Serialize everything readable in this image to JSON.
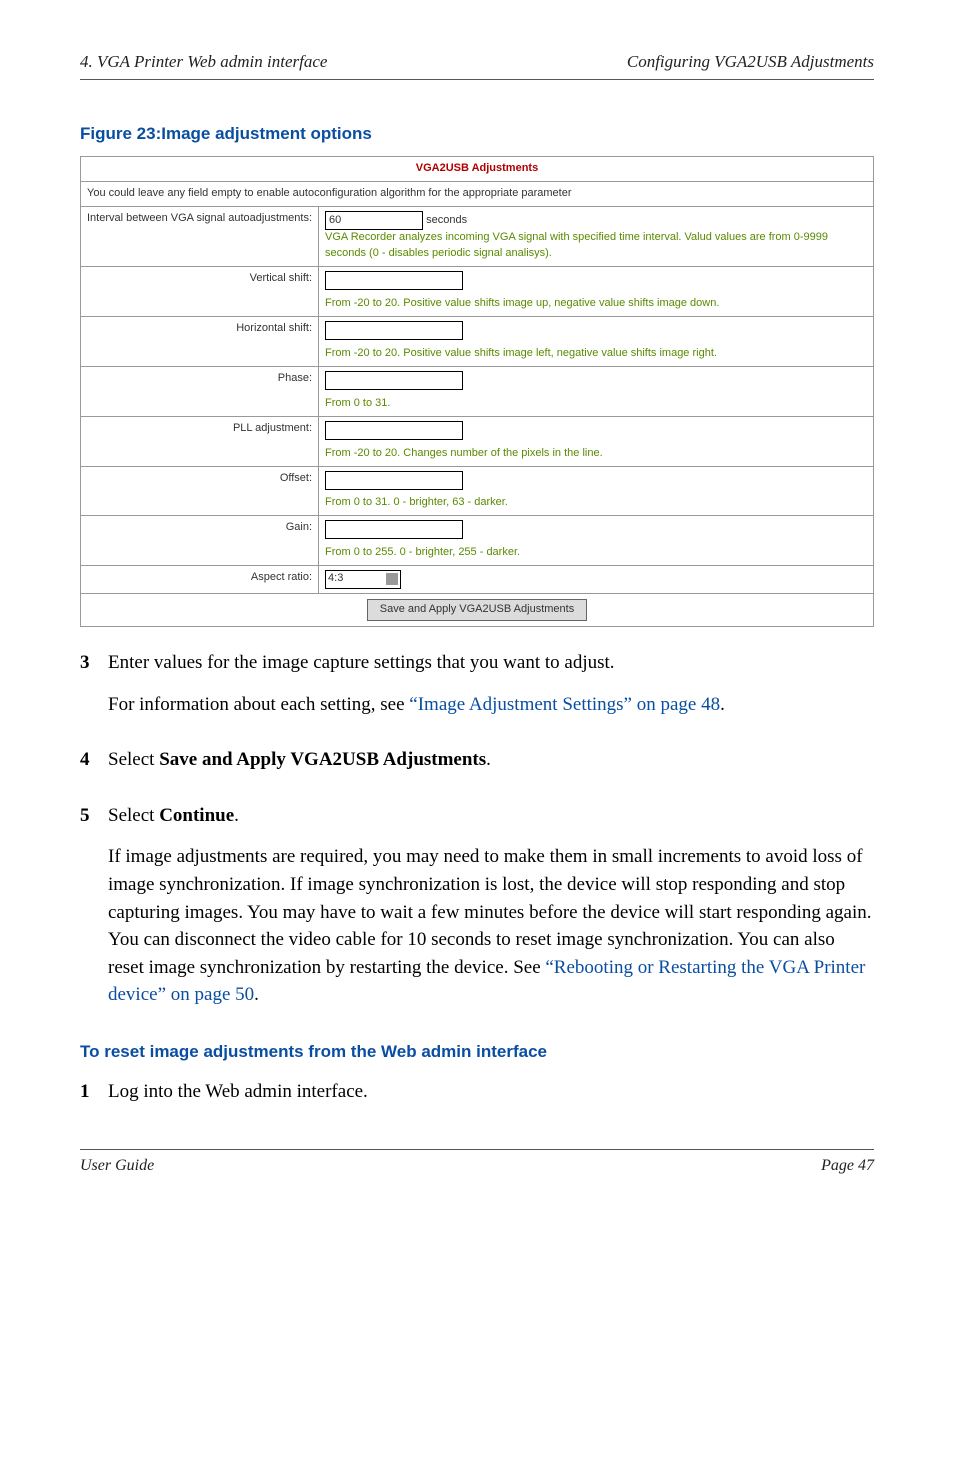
{
  "header": {
    "left": "4. VGA Printer Web admin interface",
    "right": "Configuring VGA2USB Adjustments"
  },
  "figure_caption": "Figure 23:Image adjustment options",
  "chart_data": {
    "type": "table",
    "title": "VGA2USB Adjustments",
    "subtitle": "You could leave any field empty to enable autoconfiguration algorithm for the appropriate parameter",
    "rows": [
      {
        "label": "Interval between VGA signal autoadjustments:",
        "input_value": "60",
        "after_input": "seconds",
        "help": "VGA Recorder analyzes incoming VGA signal with specified time interval. Valud values are from 0-9999 seconds (0 - disables periodic signal analisys)."
      },
      {
        "label": "Vertical shift:",
        "input_value": "",
        "help": "From -20 to 20. Positive value shifts image up, negative value shifts image down."
      },
      {
        "label": "Horizontal shift:",
        "input_value": "",
        "help": "From -20 to 20. Positive value shifts image left, negative value shifts image right."
      },
      {
        "label": "Phase:",
        "input_value": "",
        "help": "From 0 to 31."
      },
      {
        "label": "PLL adjustment:",
        "input_value": "",
        "help": "From -20 to 20. Changes number of the pixels in the line."
      },
      {
        "label": "Offset:",
        "input_value": "",
        "help": "From 0 to 31. 0 - brighter, 63 - darker."
      },
      {
        "label": "Gain:",
        "input_value": "",
        "help": "From 0 to 255. 0 - brighter, 255 - darker."
      },
      {
        "label": "Aspect ratio:",
        "select_value": "4:3"
      }
    ],
    "button_label": "Save and Apply VGA2USB Adjustments"
  },
  "steps": {
    "s3_p1": "Enter values for the image capture settings that you want to adjust.",
    "s3_p2a": "For information about each setting, see ",
    "s3_link": "“Image Adjustment Settings” on page 48",
    "s3_p2b": ".",
    "s4_a": "Select ",
    "s4_bold": "Save and Apply VGA2USB Adjustments",
    "s4_b": ".",
    "s5_a": "Select ",
    "s5_bold": "Continue",
    "s5_b": ".",
    "s5_p2a": "If image adjustments are required, you may need to make them in small increments to avoid loss of image synchronization. If image synchronization is lost, the device will stop responding and stop capturing images. You may have to wait a few minutes before the device will start responding again. You can disconnect the video cable for 10 seconds to reset image synchronization. You can also reset image synchronization by restarting the device. See ",
    "s5_link": "“Rebooting or Restarting the VGA Printer device” on page 50",
    "s5_p2b": "."
  },
  "section_heading": "To reset image adjustments from the Web admin interface",
  "step1": "Log into the Web admin interface.",
  "footer": {
    "left": "User Guide",
    "right": "Page 47"
  }
}
